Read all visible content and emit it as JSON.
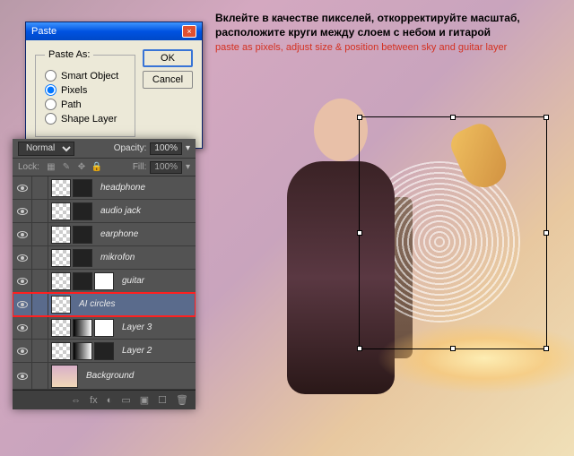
{
  "annotation": {
    "ru": "Вклейте в качестве пикселей, откорректируйте масштаб, расположите круги между слоем с небом и гитарой",
    "en": "paste as pixels, adjust size & position between sky and guitar layer"
  },
  "dialog": {
    "title": "Paste",
    "legend": "Paste As:",
    "options": {
      "smart_object": "Smart Object",
      "pixels": "Pixels",
      "path": "Path",
      "shape_layer": "Shape Layer"
    },
    "selected": "pixels",
    "ok": "OK",
    "cancel": "Cancel",
    "close": "×"
  },
  "layers_panel": {
    "blend_mode": "Normal",
    "opacity_label": "Opacity:",
    "opacity_value": "100%",
    "lock_label": "Lock:",
    "fill_label": "Fill:",
    "fill_value": "100%",
    "layers": [
      {
        "name": "headphone",
        "thumbs": [
          "checker",
          "dark"
        ]
      },
      {
        "name": "audio jack",
        "thumbs": [
          "checker",
          "dark"
        ]
      },
      {
        "name": "earphone",
        "thumbs": [
          "checker",
          "dark"
        ]
      },
      {
        "name": "mikrofon",
        "thumbs": [
          "checker",
          "dark"
        ]
      },
      {
        "name": "guitar",
        "thumbs": [
          "checker",
          "dark",
          "mask"
        ]
      },
      {
        "name": "AI circles",
        "thumbs": [
          "checker"
        ],
        "selected": true,
        "highlight": true
      },
      {
        "name": "Layer 3",
        "thumbs": [
          "checker",
          "gradient",
          "mask"
        ]
      },
      {
        "name": "Layer 2",
        "thumbs": [
          "checker",
          "gradient",
          "dark"
        ]
      },
      {
        "name": "Background",
        "thumbs": [
          "bg"
        ],
        "bg": true
      }
    ],
    "footer_icons": [
      "fx",
      "◐",
      "▭",
      "▣",
      "☐",
      "🗑"
    ]
  }
}
